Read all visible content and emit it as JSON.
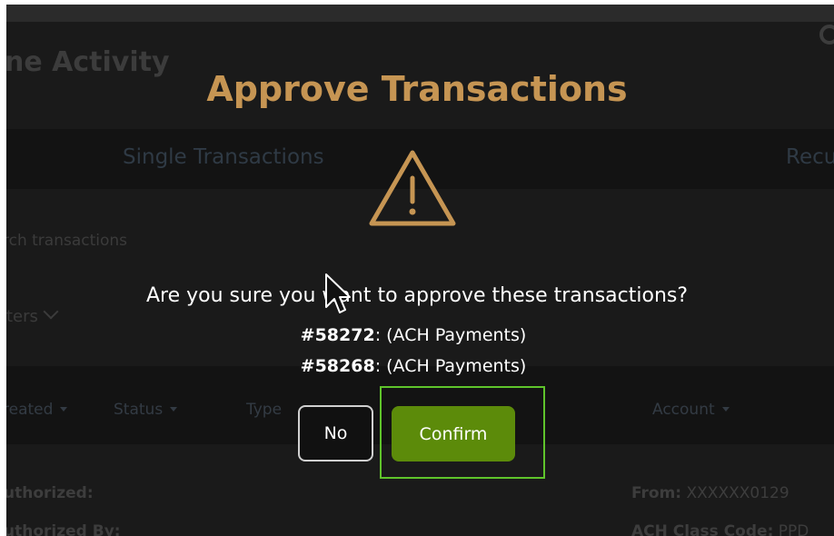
{
  "background": {
    "heading": "ne Activity",
    "tabs": {
      "single": "Single Transactions",
      "recurring": "Recu"
    },
    "search_text": "rch transactions",
    "filters_label": "ters",
    "columns": [
      {
        "label": "reated"
      },
      {
        "label": "Status"
      },
      {
        "label": "Type"
      },
      {
        "label": "Account"
      }
    ],
    "rows": {
      "authorized_label": "uthorized:",
      "authorized_by_label": "uthorized By:",
      "from_label": "From:",
      "from_value": "XXXXXX0129",
      "ach_class_label": "ACH Class Code:",
      "ach_class_value": "PPD"
    }
  },
  "modal": {
    "title": "Approve Transactions",
    "question": "Are you sure you want to approve these transactions?",
    "transactions": [
      {
        "id": "#58272",
        "detail": ": (ACH Payments)"
      },
      {
        "id": "#58268",
        "detail": ": (ACH Payments)"
      }
    ],
    "buttons": {
      "no": "No",
      "confirm": "Confirm"
    }
  },
  "colors": {
    "title": "#c69553",
    "confirm_bg": "#5c8b0a",
    "highlight": "#5fc42b",
    "warning_icon": "#c69553"
  },
  "icons": {
    "warning": "warning-triangle-icon",
    "cursor": "mouse-pointer-icon",
    "settings": "gear-icon"
  }
}
